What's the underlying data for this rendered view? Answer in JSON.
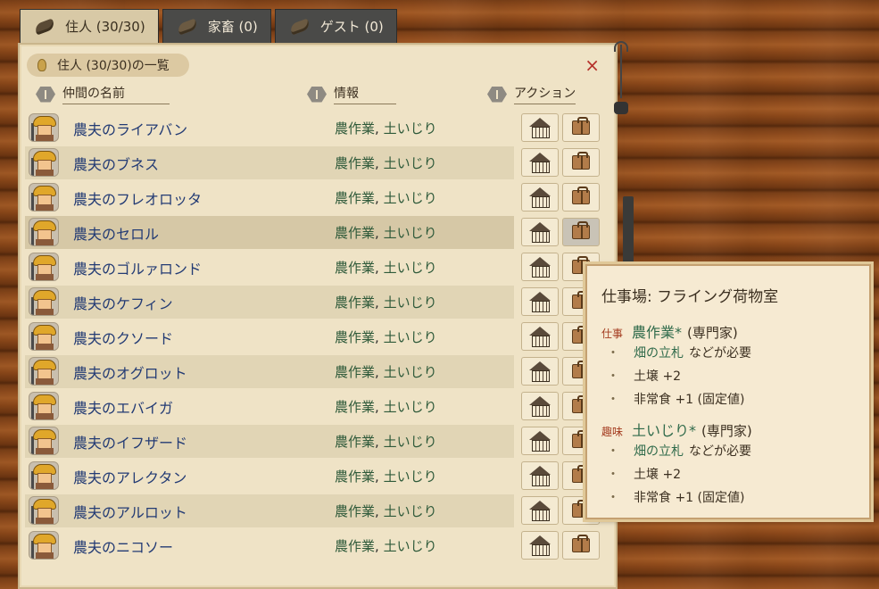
{
  "tabs": [
    {
      "label": "住人 (30/30)",
      "active": true
    },
    {
      "label": "家畜 (0)",
      "active": false
    },
    {
      "label": "ゲスト (0)",
      "active": false
    }
  ],
  "panel": {
    "title": "住人 (30/30)の一覧",
    "close": "×",
    "headers": {
      "name": "仲間の名前",
      "info": "情報",
      "action": "アクション"
    }
  },
  "rows": [
    {
      "name": "農夫のライアバン",
      "job": "農作業",
      "sep": ",",
      "hobby": "土いじり"
    },
    {
      "name": "農夫のブネス",
      "job": "農作業",
      "sep": ",",
      "hobby": "土いじり"
    },
    {
      "name": "農夫のフレオロッタ",
      "job": "農作業",
      "sep": ",",
      "hobby": "土いじり"
    },
    {
      "name": "農夫のセロル",
      "job": "農作業",
      "sep": ",",
      "hobby": "土いじり"
    },
    {
      "name": "農夫のゴルァロンド",
      "job": "農作業",
      "sep": ",",
      "hobby": "土いじり"
    },
    {
      "name": "農夫のケフィン",
      "job": "農作業",
      "sep": ",",
      "hobby": "土いじり"
    },
    {
      "name": "農夫のクソード",
      "job": "農作業",
      "sep": ",",
      "hobby": "土いじり"
    },
    {
      "name": "農夫のオグロット",
      "job": "農作業",
      "sep": ",",
      "hobby": "土いじり"
    },
    {
      "name": "農夫のエバイガ",
      "job": "農作業",
      "sep": ",",
      "hobby": "土いじり"
    },
    {
      "name": "農夫のイフザード",
      "job": "農作業",
      "sep": ",",
      "hobby": "土いじり"
    },
    {
      "name": "農夫のアレクタン",
      "job": "農作業",
      "sep": ",",
      "hobby": "土いじり"
    },
    {
      "name": "農夫のアルロット",
      "job": "農作業",
      "sep": ",",
      "hobby": "土いじり"
    },
    {
      "name": "農夫のニコソー",
      "job": "農作業",
      "sep": ",",
      "hobby": "土いじり"
    }
  ],
  "tooltip": {
    "title": "仕事場: フライング荷物室",
    "job_tag": "仕事",
    "job_skill": "農作業*",
    "job_level": "(専門家)",
    "job_req_link": "畑の立札",
    "job_req_text": "などが必要",
    "job_bonus1": "土壌 +2",
    "job_bonus2": "非常食 +1 (固定値)",
    "hobby_tag": "趣味",
    "hobby_skill": "土いじり*",
    "hobby_level": "(専門家)",
    "hobby_req_link": "畑の立札",
    "hobby_req_text": "などが必要",
    "hobby_bonus1": "土壌 +2",
    "hobby_bonus2": "非常食 +1 (固定値)",
    "bullet": "・"
  }
}
